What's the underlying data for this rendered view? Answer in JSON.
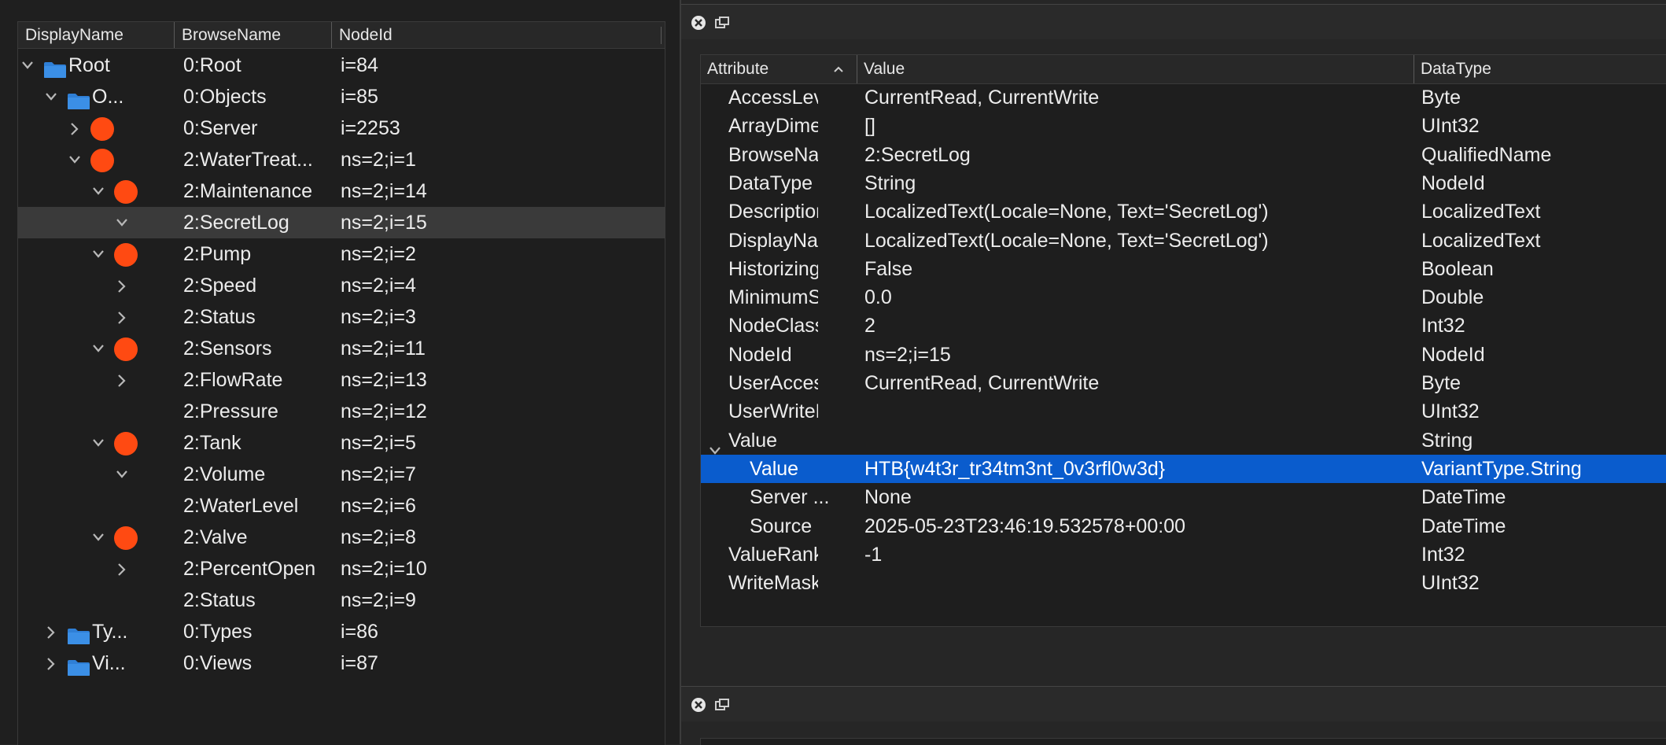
{
  "tree": {
    "columns": [
      "DisplayName",
      "BrowseName",
      "NodeId"
    ],
    "rows": [
      {
        "display": "Root",
        "browse": "0:Root",
        "nodeid": "i=84",
        "expander": "expanded",
        "icon": "folder"
      },
      {
        "display": "O...",
        "browse": "0:Objects",
        "nodeid": "i=85",
        "expander": "expanded",
        "icon": "folder"
      },
      {
        "display": "",
        "browse": "0:Server",
        "nodeid": "i=2253",
        "expander": "collapsed",
        "icon": "object"
      },
      {
        "display": "",
        "browse": "2:WaterTreat...",
        "nodeid": "ns=2;i=1",
        "expander": "expanded",
        "icon": "object"
      },
      {
        "display": "",
        "browse": "2:Maintenance",
        "nodeid": "ns=2;i=14",
        "expander": "expanded",
        "icon": "object"
      },
      {
        "display": "",
        "browse": "2:SecretLog",
        "nodeid": "ns=2;i=15",
        "expander": "expanded",
        "icon": "none",
        "selected": true
      },
      {
        "display": "",
        "browse": "2:Pump",
        "nodeid": "ns=2;i=2",
        "expander": "expanded",
        "icon": "object"
      },
      {
        "display": "",
        "browse": "2:Speed",
        "nodeid": "ns=2;i=4",
        "expander": "collapsed",
        "icon": "none"
      },
      {
        "display": "",
        "browse": "2:Status",
        "nodeid": "ns=2;i=3",
        "expander": "collapsed",
        "icon": "none"
      },
      {
        "display": "",
        "browse": "2:Sensors",
        "nodeid": "ns=2;i=11",
        "expander": "expanded",
        "icon": "object"
      },
      {
        "display": "",
        "browse": "2:FlowRate",
        "nodeid": "ns=2;i=13",
        "expander": "collapsed",
        "icon": "none"
      },
      {
        "display": "",
        "browse": "2:Pressure",
        "nodeid": "ns=2;i=12",
        "expander": "none",
        "icon": "none"
      },
      {
        "display": "",
        "browse": "2:Tank",
        "nodeid": "ns=2;i=5",
        "expander": "expanded",
        "icon": "object"
      },
      {
        "display": "",
        "browse": "2:Volume",
        "nodeid": "ns=2;i=7",
        "expander": "expanded",
        "icon": "none"
      },
      {
        "display": "",
        "browse": "2:WaterLevel",
        "nodeid": "ns=2;i=6",
        "expander": "none",
        "icon": "none"
      },
      {
        "display": "",
        "browse": "2:Valve",
        "nodeid": "ns=2;i=8",
        "expander": "expanded",
        "icon": "object"
      },
      {
        "display": "",
        "browse": "2:PercentOpen",
        "nodeid": "ns=2;i=10",
        "expander": "collapsed",
        "icon": "none"
      },
      {
        "display": "",
        "browse": "2:Status",
        "nodeid": "ns=2;i=9",
        "expander": "none",
        "icon": "none"
      },
      {
        "display": "Ty...",
        "browse": "0:Types",
        "nodeid": "i=86",
        "expander": "collapsed",
        "icon": "folder"
      },
      {
        "display": "Vi...",
        "browse": "0:Views",
        "nodeid": "i=87",
        "expander": "collapsed",
        "icon": "folder"
      }
    ]
  },
  "attributes": {
    "columns": [
      "Attribute",
      "Value",
      "DataType"
    ],
    "rows": [
      {
        "name": "AccessLevel",
        "value": "CurrentRead, CurrentWrite",
        "type": "Byte"
      },
      {
        "name": "ArrayDimensions",
        "value": "[]",
        "type": "UInt32"
      },
      {
        "name": "BrowseName",
        "value": "2:SecretLog",
        "type": "QualifiedName"
      },
      {
        "name": "DataType",
        "value": "String",
        "type": "NodeId"
      },
      {
        "name": "Description",
        "value": "LocalizedText(Locale=None, Text='SecretLog')",
        "type": "LocalizedText"
      },
      {
        "name": "DisplayName",
        "value": "LocalizedText(Locale=None, Text='SecretLog')",
        "type": "LocalizedText"
      },
      {
        "name": "Historizing",
        "value": "False",
        "type": "Boolean"
      },
      {
        "name": "MinimumSamplingInterval",
        "value": "0.0",
        "type": "Double"
      },
      {
        "name": "NodeClass",
        "value": "2",
        "type": "Int32"
      },
      {
        "name": "NodeId",
        "value": "ns=2;i=15",
        "type": "NodeId"
      },
      {
        "name": "UserAccessLevel",
        "value": "CurrentRead, CurrentWrite",
        "type": "Byte"
      },
      {
        "name": "UserWriteMask",
        "value": "",
        "type": "UInt32"
      },
      {
        "name": "Value",
        "value": "",
        "type": "String",
        "expander": "expanded"
      },
      {
        "name": "Value",
        "value": "HTB{w4t3r_tr34tm3nt_0v3rfl0w3d}",
        "type": "VariantType.String",
        "child": true,
        "selected": true
      },
      {
        "name": "Server ...",
        "value": "None",
        "type": "DateTime",
        "child": true
      },
      {
        "name": "Source",
        "value": "2025-05-23T23:46:19.532578+00:00",
        "type": "DateTime",
        "child": true
      },
      {
        "name": "ValueRank",
        "value": "-1",
        "type": "Int32"
      },
      {
        "name": "WriteMask",
        "value": "",
        "type": "UInt32"
      }
    ]
  },
  "colors": {
    "selection": "#0a5ccd",
    "object_icon": "#ff4a12",
    "folder_icon": "#2f7fd6"
  },
  "icons": {
    "close": "close-icon",
    "float": "float-window-icon",
    "folder": "folder-icon",
    "object": "object-node-icon"
  }
}
